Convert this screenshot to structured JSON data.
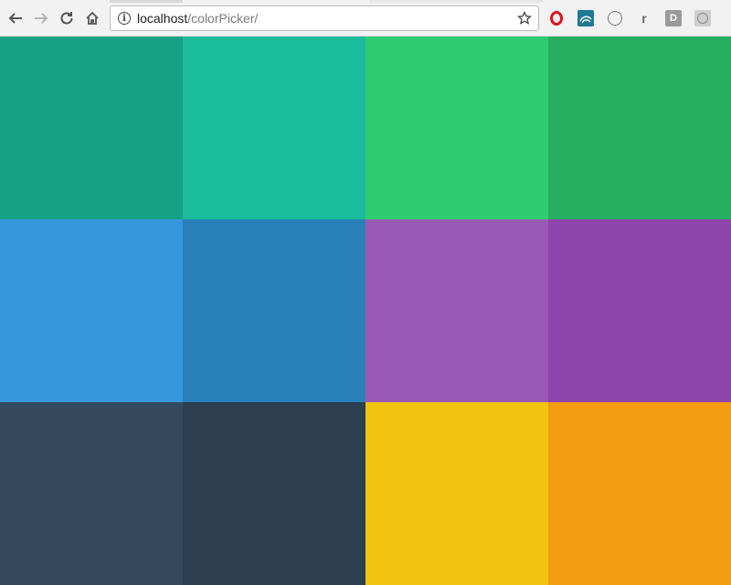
{
  "browser": {
    "address": {
      "host": "localhost",
      "path": "/colorPicker/"
    },
    "icons": {
      "back": "back-arrow-icon",
      "forward": "forward-arrow-icon",
      "reload": "reload-icon",
      "home": "home-icon",
      "info": "info-icon",
      "bookmark": "star-icon"
    },
    "extensions": [
      {
        "name": "opera-icon",
        "label": ""
      },
      {
        "name": "wave-icon",
        "label": ""
      },
      {
        "name": "github-icon",
        "label": ""
      },
      {
        "name": "r-extension-icon",
        "label": "r"
      },
      {
        "name": "d-extension-icon",
        "label": "D"
      },
      {
        "name": "react-devtools-icon",
        "label": ""
      }
    ]
  },
  "swatches": [
    {
      "name": "swatch-green-sea",
      "color": "#16a085"
    },
    {
      "name": "swatch-turquoise",
      "color": "#1abc9c"
    },
    {
      "name": "swatch-emerald",
      "color": "#2ecc71"
    },
    {
      "name": "swatch-nephritis",
      "color": "#27ae60"
    },
    {
      "name": "swatch-peter-river",
      "color": "#3498db"
    },
    {
      "name": "swatch-belize-hole",
      "color": "#2980b9"
    },
    {
      "name": "swatch-amethyst",
      "color": "#9b59b6"
    },
    {
      "name": "swatch-wisteria",
      "color": "#8e44ad"
    },
    {
      "name": "swatch-wet-asphalt",
      "color": "#34495e"
    },
    {
      "name": "swatch-midnight-blue",
      "color": "#2c3e50"
    },
    {
      "name": "swatch-sunflower",
      "color": "#f1c40f"
    },
    {
      "name": "swatch-orange",
      "color": "#f39c12"
    }
  ]
}
